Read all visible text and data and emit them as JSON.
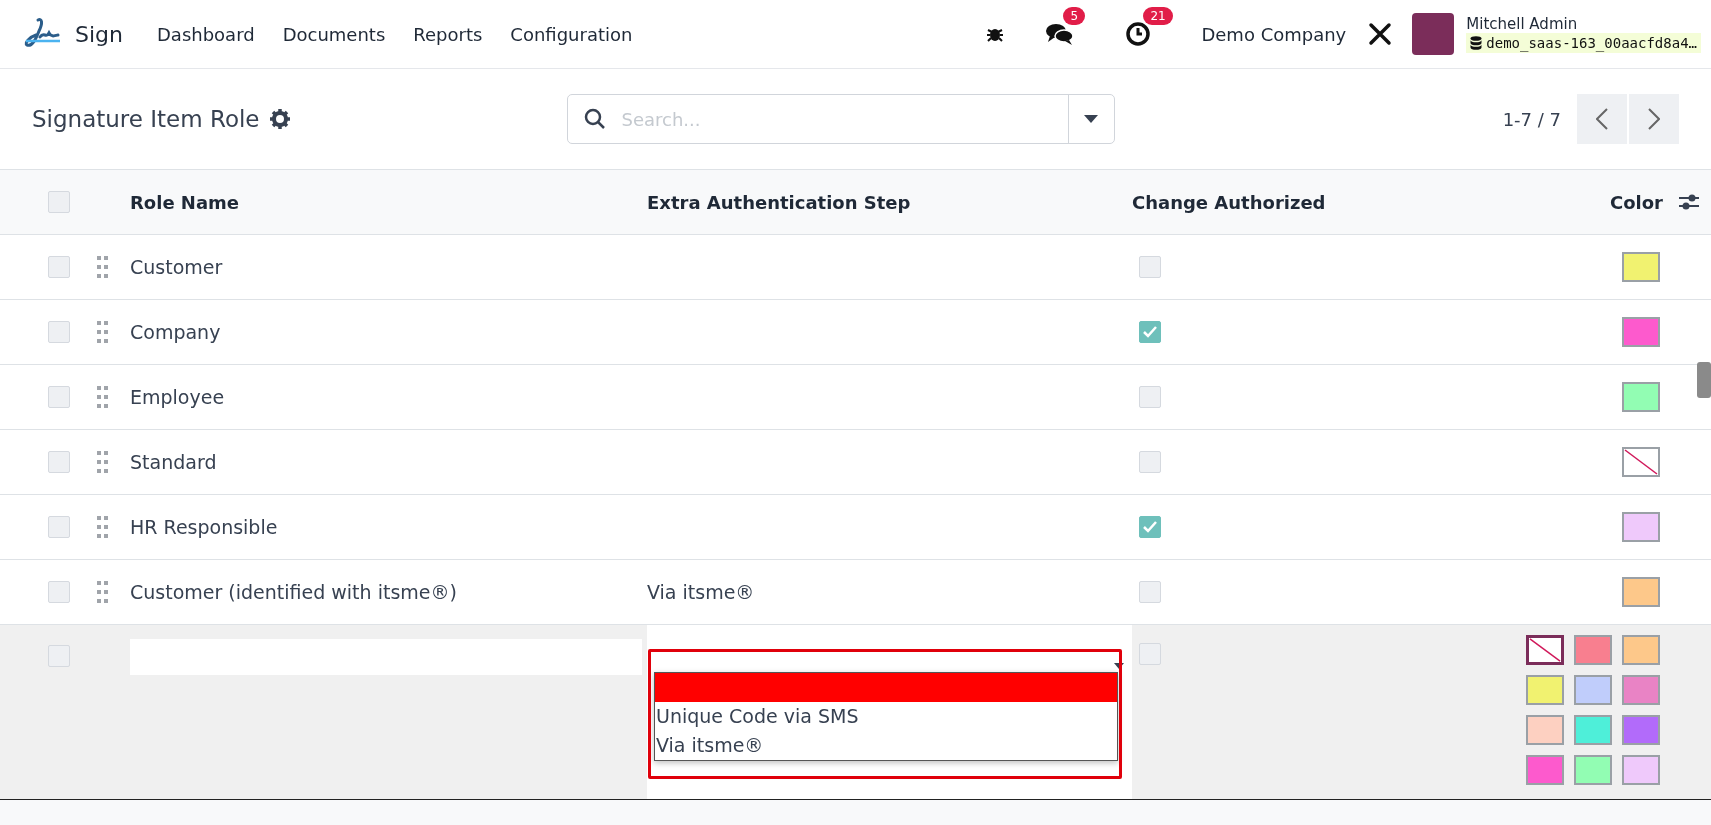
{
  "navbar": {
    "app_name": "Sign",
    "menu": [
      {
        "label": "Dashboard"
      },
      {
        "label": "Documents"
      },
      {
        "label": "Reports"
      },
      {
        "label": "Configuration"
      }
    ],
    "messages_badge": "5",
    "activities_badge": "21",
    "company": "Demo Company",
    "user": {
      "name": "Mitchell Admin",
      "database": "demo_saas-163_00aacfd8a4…"
    }
  },
  "control_panel": {
    "title": "Signature Item Role",
    "search": {
      "placeholder": "Search..."
    },
    "pager": "1-7 / 7"
  },
  "table": {
    "select_all": false,
    "columns": [
      {
        "label": "Role Name"
      },
      {
        "label": "Extra Authentication Step"
      },
      {
        "label": "Change Authorized"
      },
      {
        "label": "Color"
      }
    ],
    "rows": [
      {
        "selected": false,
        "role_name": "Customer",
        "change_authorized": false,
        "kind": "color",
        "color": "#f1f270"
      },
      {
        "selected": false,
        "role_name": "Company",
        "change_authorized": true,
        "kind": "color",
        "color": "#fd5acd"
      },
      {
        "selected": false,
        "role_name": "Employee",
        "change_authorized": false,
        "kind": "color",
        "color": "#92fdb3"
      },
      {
        "selected": false,
        "role_name": "Standard",
        "change_authorized": false,
        "kind": "no-color"
      },
      {
        "selected": false,
        "role_name": "HR Responsible",
        "change_authorized": true,
        "kind": "color",
        "color": "#efc9fb"
      },
      {
        "selected": false,
        "role_name": "Customer (identified with itsme®)",
        "auth_step": "Via itsme®",
        "change_authorized": false,
        "kind": "color",
        "color": "#fdc88a"
      }
    ],
    "edit_row": {
      "selected": false,
      "change_authorized": false,
      "auth_options": [
        {
          "kind": "blank",
          "selected": true
        },
        {
          "kind": "option",
          "label": "Unique Code via SMS",
          "selected": false
        },
        {
          "kind": "option",
          "label": "Via itsme®",
          "selected": false
        }
      ],
      "annotation": {
        "kind": "rectangle"
      },
      "palette": [
        {
          "kind": "no-color",
          "selected": true
        },
        {
          "kind": "color",
          "color": "#f87f8f",
          "selected": false
        },
        {
          "kind": "color",
          "color": "#fdc88a",
          "selected": false
        },
        {
          "kind": "color",
          "color": "#f1f270",
          "selected": false
        },
        {
          "kind": "color",
          "color": "#c0cdfb",
          "selected": false
        },
        {
          "kind": "color",
          "color": "#e983c5",
          "selected": false
        },
        {
          "kind": "color",
          "color": "#fdd0c1",
          "selected": false
        },
        {
          "kind": "color",
          "color": "#4eefd9",
          "selected": false
        },
        {
          "kind": "color",
          "color": "#b26bfa",
          "selected": false
        },
        {
          "kind": "color",
          "color": "#fd5acd",
          "selected": false
        },
        {
          "kind": "color",
          "color": "#92fdb3",
          "selected": false
        },
        {
          "kind": "color",
          "color": "#efc9fb",
          "selected": false
        }
      ]
    }
  }
}
